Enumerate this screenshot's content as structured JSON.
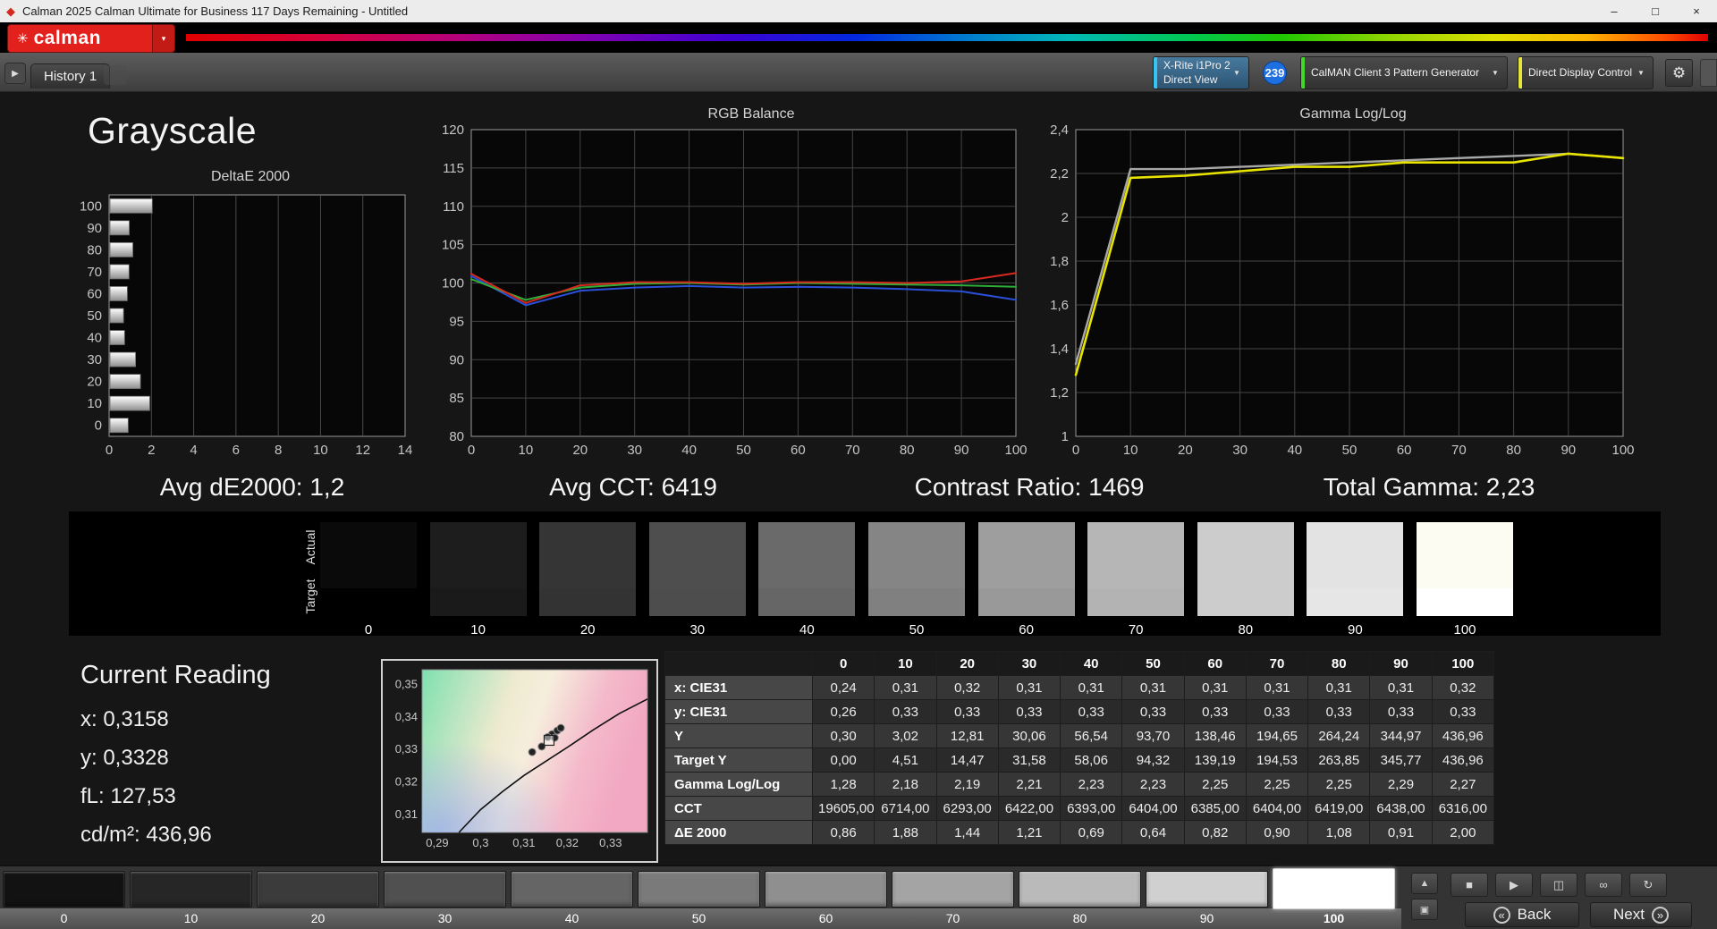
{
  "window": {
    "title": "Calman 2025 Calman Ultimate for Business 117 Days Remaining  - Untitled",
    "app_icon": "◆",
    "controls": [
      {
        "name": "minimize",
        "glyph": "–"
      },
      {
        "name": "maximize",
        "glyph": "□"
      },
      {
        "name": "close",
        "glyph": "×"
      }
    ]
  },
  "brand": {
    "logo_text": "calman",
    "logo_mark": "✳",
    "red": "#e2201c",
    "dropdown_arrow": "▾"
  },
  "toolbar": {
    "history_panel_icon": "▶",
    "history_tab": "History 1",
    "meter_line1": "X-Rite i1Pro 2",
    "meter_line2": "Direct View",
    "meter_accent": "#38c4f0",
    "badge": "239",
    "badge_color": "#1e6fe0",
    "pattern_generator": "CalMAN Client 3 Pattern Generator",
    "pattern_accent": "#46d62a",
    "display_control": "Direct Display Control",
    "display_accent": "#e6e63a",
    "gear_icon": "⚙",
    "dropdown_arrow": "▼"
  },
  "page_title": "Grayscale",
  "stats": [
    "Avg dE2000: 1,2",
    "Avg CCT: 6419",
    "Contrast Ratio: 1469",
    "Total Gamma: 2,23"
  ],
  "chart_data": [
    {
      "id": "deltae2000",
      "type": "bar",
      "orientation": "horizontal",
      "title": "DeltaE 2000",
      "categories": [
        "100",
        "90",
        "80",
        "70",
        "60",
        "50",
        "40",
        "30",
        "20",
        "10",
        "0"
      ],
      "values": [
        2.0,
        0.91,
        1.08,
        0.9,
        0.82,
        0.64,
        0.69,
        1.21,
        1.44,
        1.88,
        0.86
      ],
      "xlim": [
        0,
        14
      ],
      "xticks": [
        0,
        2,
        4,
        6,
        8,
        10,
        12,
        14
      ],
      "grid": "vertical"
    },
    {
      "id": "rgb_balance",
      "type": "line",
      "title": "RGB Balance",
      "x": [
        0,
        10,
        20,
        30,
        40,
        50,
        60,
        70,
        80,
        90,
        100
      ],
      "xticks": [
        0,
        10,
        20,
        30,
        40,
        50,
        60,
        70,
        80,
        90,
        100
      ],
      "xlim": [
        0,
        100
      ],
      "ylim": [
        80,
        120
      ],
      "yticks": [
        80,
        85,
        90,
        95,
        100,
        105,
        110,
        115,
        120
      ],
      "grid": "both",
      "series": [
        {
          "name": "Blue",
          "color": "#2b50d8",
          "values": [
            100.9,
            97.1,
            99.0,
            99.4,
            99.6,
            99.4,
            99.5,
            99.4,
            99.2,
            98.9,
            97.8
          ]
        },
        {
          "name": "Green",
          "color": "#2fae3a",
          "values": [
            100.5,
            97.8,
            99.4,
            99.9,
            100.0,
            99.8,
            100.0,
            99.9,
            99.8,
            99.7,
            99.5
          ]
        },
        {
          "name": "Red",
          "color": "#d82b20",
          "values": [
            101.2,
            97.4,
            99.7,
            100.1,
            100.1,
            99.9,
            100.1,
            100.1,
            100.0,
            100.2,
            101.3
          ]
        }
      ]
    },
    {
      "id": "gamma_loglog",
      "type": "line",
      "title": "Gamma Log/Log",
      "x": [
        0,
        10,
        20,
        30,
        40,
        50,
        60,
        70,
        80,
        90,
        100
      ],
      "xticks": [
        0,
        10,
        20,
        30,
        40,
        50,
        60,
        70,
        80,
        90,
        100
      ],
      "xlim": [
        0,
        100
      ],
      "ylim": [
        1,
        2.4
      ],
      "yticks": [
        1,
        1.2,
        1.4,
        1.6,
        1.8,
        2,
        2.2,
        2.4
      ],
      "ytick_labels": [
        "1",
        "1,2",
        "1,4",
        "1,6",
        "1,8",
        "2",
        "2,2",
        "2,4"
      ],
      "grid": "both",
      "series": [
        {
          "name": "Target Gamma",
          "color": "#a8a8a8",
          "width": 2.4,
          "values": [
            1.33,
            2.22,
            2.22,
            2.23,
            2.24,
            2.25,
            2.26,
            2.27,
            2.28,
            2.29,
            2.27
          ]
        },
        {
          "name": "Measured Gamma",
          "color": "#e8e400",
          "width": 2.6,
          "values": [
            1.28,
            2.18,
            2.19,
            2.21,
            2.23,
            2.23,
            2.25,
            2.25,
            2.25,
            2.29,
            2.27
          ]
        }
      ]
    },
    {
      "id": "cie_chromaticity_detail",
      "type": "scatter",
      "title": "",
      "xlim": [
        0.2865,
        0.3385
      ],
      "ylim": [
        0.3045,
        0.3545
      ],
      "xticks": [
        0.29,
        0.3,
        0.31,
        0.32,
        0.33
      ],
      "xtick_labels": [
        "0,29",
        "0,3",
        "0,31",
        "0,32",
        "0,33"
      ],
      "yticks": [
        0.35,
        0.34,
        0.33,
        0.32,
        0.31
      ],
      "ytick_labels": [
        "0,35",
        "0,34",
        "0,33",
        "0,32",
        "0,31"
      ],
      "locus": [
        [
          0.295,
          0.3045
        ],
        [
          0.3,
          0.3115
        ],
        [
          0.305,
          0.317
        ],
        [
          0.31,
          0.322
        ],
        [
          0.3158,
          0.327
        ],
        [
          0.321,
          0.3315
        ],
        [
          0.326,
          0.336
        ],
        [
          0.332,
          0.341
        ],
        [
          0.3385,
          0.3455
        ]
      ],
      "points": [
        [
          0.3165,
          0.3347
        ],
        [
          0.3177,
          0.3358
        ],
        [
          0.3185,
          0.3366
        ],
        [
          0.3155,
          0.3338
        ],
        [
          0.3171,
          0.3336
        ],
        [
          0.3141,
          0.3309
        ],
        [
          0.3119,
          0.3292
        ]
      ],
      "marker": [
        0.3158,
        0.3328
      ]
    }
  ],
  "grayscale_strip": {
    "row_labels": [
      "Actual",
      "Target"
    ],
    "levels": [
      "0",
      "10",
      "20",
      "30",
      "40",
      "50",
      "60",
      "70",
      "80",
      "90",
      "100"
    ],
    "colors_actual": [
      "#0a0a0a",
      "#1d1d1d",
      "#353535",
      "#4e4e4e",
      "#6a6a6a",
      "#858585",
      "#9e9e9e",
      "#b6b6b6",
      "#cccccc",
      "#e3e3e3",
      "#fdfcf2"
    ],
    "colors_target": [
      "#000000",
      "#1a1a1a",
      "#333333",
      "#4d4d4d",
      "#666666",
      "#808080",
      "#999999",
      "#b3b3b3",
      "#cccccc",
      "#e6e6e6",
      "#ffffff"
    ]
  },
  "current_reading": {
    "title": "Current Reading",
    "lines": [
      "x: 0,3158",
      "y: 0,3328",
      "fL: 127,53",
      "cd/m²: 436,96"
    ]
  },
  "measurement_table": {
    "columns": [
      "",
      "0",
      "10",
      "20",
      "30",
      "40",
      "50",
      "60",
      "70",
      "80",
      "90",
      "100"
    ],
    "rows": [
      {
        "label": "x: CIE31",
        "values": [
          "0,24",
          "0,31",
          "0,32",
          "0,31",
          "0,31",
          "0,31",
          "0,31",
          "0,31",
          "0,31",
          "0,31",
          "0,32"
        ]
      },
      {
        "label": "y: CIE31",
        "values": [
          "0,26",
          "0,33",
          "0,33",
          "0,33",
          "0,33",
          "0,33",
          "0,33",
          "0,33",
          "0,33",
          "0,33",
          "0,33"
        ]
      },
      {
        "label": "Y",
        "values": [
          "0,30",
          "3,02",
          "12,81",
          "30,06",
          "56,54",
          "93,70",
          "138,46",
          "194,65",
          "264,24",
          "344,97",
          "436,96"
        ]
      },
      {
        "label": "Target Y",
        "values": [
          "0,00",
          "4,51",
          "14,47",
          "31,58",
          "58,06",
          "94,32",
          "139,19",
          "194,53",
          "263,85",
          "345,77",
          "436,96"
        ]
      },
      {
        "label": "Gamma Log/Log",
        "values": [
          "1,28",
          "2,18",
          "2,19",
          "2,21",
          "2,23",
          "2,23",
          "2,25",
          "2,25",
          "2,25",
          "2,29",
          "2,27"
        ]
      },
      {
        "label": "CCT",
        "values": [
          "19605,00",
          "6714,00",
          "6293,00",
          "6422,00",
          "6393,00",
          "6404,00",
          "6385,00",
          "6404,00",
          "6419,00",
          "6438,00",
          "6316,00"
        ]
      },
      {
        "label": "ΔE 2000",
        "values": [
          "0,86",
          "1,88",
          "1,44",
          "1,21",
          "0,69",
          "0,64",
          "0,82",
          "0,90",
          "1,08",
          "0,91",
          "2,00"
        ]
      }
    ]
  },
  "pattern_bar": {
    "levels": [
      "0",
      "10",
      "20",
      "30",
      "40",
      "50",
      "60",
      "70",
      "80",
      "90",
      "100"
    ],
    "selected_index": 10,
    "colors": [
      "#121212",
      "#262626",
      "#3b3b3b",
      "#505050",
      "#656565",
      "#7a7a7a",
      "#8f8f8f",
      "#a4a4a4",
      "#bababa",
      "#d0d0d0",
      "#ffffff"
    ]
  },
  "transport": {
    "stack_buttons": [
      {
        "name": "eject-icon-button",
        "glyph": "▲"
      },
      {
        "name": "pattern-window-button",
        "glyph": "▣"
      }
    ],
    "buttons": [
      {
        "name": "stop",
        "glyph": "■"
      },
      {
        "name": "play",
        "glyph": "▶"
      },
      {
        "name": "save",
        "glyph": "◫"
      },
      {
        "name": "continuous-measure",
        "glyph": "∞"
      },
      {
        "name": "refresh",
        "glyph": "↻"
      }
    ],
    "back_icon": "«",
    "back_label": "Back",
    "next_label": "Next",
    "next_icon": "»"
  }
}
